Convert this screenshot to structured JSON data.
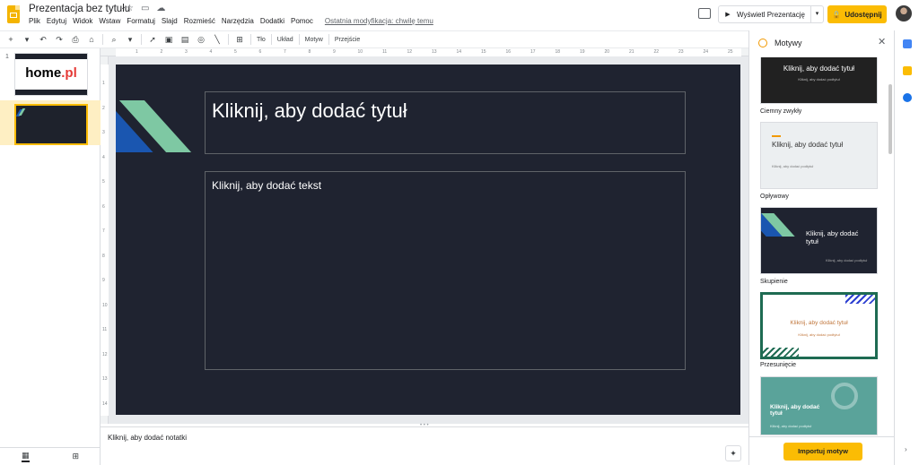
{
  "header": {
    "doc_title": "Prezentacja bez tytułu",
    "menu": [
      "Plik",
      "Edytuj",
      "Widok",
      "Wstaw",
      "Formatuj",
      "Slajd",
      "Rozmieść",
      "Narzędzia",
      "Dodatki",
      "Pomoc"
    ],
    "last_modified": "Ostatnia modyfikacja: chwilę temu",
    "present_label": "Wyświetl Prezentację",
    "share_label": "Udostępnij"
  },
  "toolbar": {
    "background_label": "Tło",
    "layout_label": "Układ",
    "theme_label": "Motyw",
    "transition_label": "Przejście"
  },
  "filmstrip": {
    "slides": [
      {
        "number": "1",
        "brand_text": "home",
        "brand_dot": ".pl"
      },
      {
        "number": "2"
      }
    ]
  },
  "ruler": {
    "top": [
      "1",
      "2",
      "3",
      "4",
      "5",
      "6",
      "7",
      "8",
      "9",
      "10",
      "11",
      "12",
      "13",
      "14",
      "15",
      "16",
      "17",
      "18",
      "19",
      "20",
      "21",
      "22",
      "23",
      "24",
      "25"
    ],
    "left": [
      "1",
      "2",
      "3",
      "4",
      "5",
      "6",
      "7",
      "8",
      "9",
      "10",
      "11",
      "12",
      "13",
      "14"
    ]
  },
  "slide": {
    "title_placeholder": "Kliknij, aby dodać tytuł",
    "body_placeholder": "Kliknij, aby dodać tekst"
  },
  "notes": {
    "placeholder": "Kliknij, aby dodać notatki"
  },
  "themes_panel": {
    "title": "Motywy",
    "themes": [
      {
        "name": "Ciemny zwykły",
        "card_title": "Kliknij, aby dodać tytuł",
        "card_sub": "Kliknij, aby dodać podtytuł"
      },
      {
        "name": "Opływowy",
        "card_title": "Kliknij, aby dodać tytuł",
        "card_sub": "Kliknij, aby dodać podtytuł"
      },
      {
        "name": "Skupienie",
        "card_title": "Kliknij, aby dodać tytuł",
        "card_sub": "Kliknij, aby dodać podtytuł"
      },
      {
        "name": "Przesunięcie",
        "card_title": "Kliknij, aby dodać tytuł",
        "card_sub": "Kliknij, aby dodać podtytuł"
      },
      {
        "name": "",
        "card_title": "Kliknij, aby dodać tytuł",
        "card_sub": "Kliknij, aby dodać podtytuł"
      }
    ],
    "import_label": "Importuj motyw"
  },
  "colors": {
    "accent_yellow": "#fbbc04",
    "slide_bg": "#1f2330",
    "shape_blue": "#1a56b0",
    "shape_green": "#7ec8a3"
  }
}
